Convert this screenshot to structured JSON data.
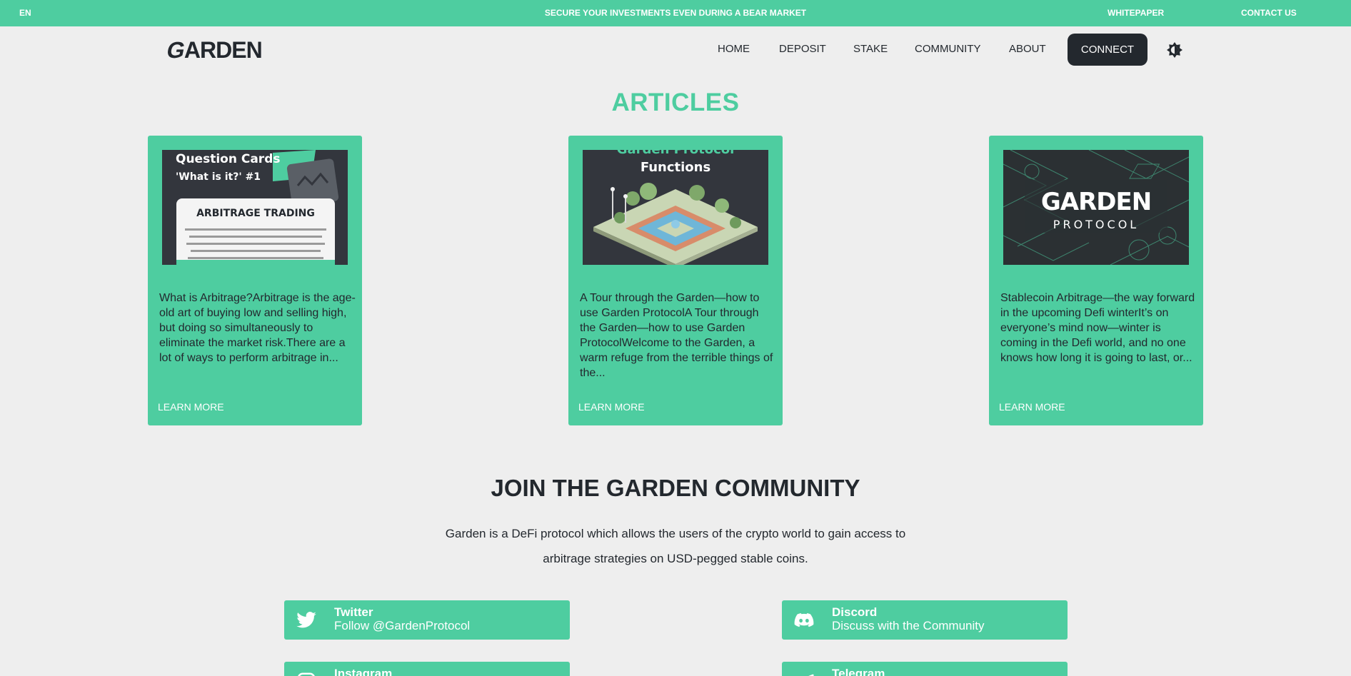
{
  "topbar": {
    "lang": "EN",
    "message": "SECURE YOUR INVESTMENTS EVEN DURING A BEAR MARKET",
    "whitepaper": "WHITEPAPER",
    "contact": "CONTACT US"
  },
  "header": {
    "logo_text": "ARDEN",
    "logo_initial": "G",
    "nav": {
      "home": "HOME",
      "deposit": "DEPOSIT",
      "stake": "STAKE",
      "community": "COMMUNITY",
      "about": "ABOUT"
    },
    "connect": "CONNECT",
    "theme_icon": "brightness-icon"
  },
  "articles": {
    "title": "ARTICLES",
    "learn_more": "LEARN MORE",
    "items": [
      {
        "image_title_1": "Question Cards",
        "image_title_2": "'What is it?' #1",
        "image_card_heading": "ARBITRAGE TRADING",
        "text": "What is Arbitrage?Arbitrage is the age-old art of buying low and selling high, but doing so simultaneously to eliminate the market risk.There are a lot of ways to perform arbitrage in..."
      },
      {
        "image_title_1": "Garden Protocol",
        "image_title_2": "Functions",
        "text": "A Tour through the Garden—how to use Garden ProtocolA Tour through the Garden—how to use Garden ProtocolWelcome to the Garden, a warm refuge from the terrible things of the..."
      },
      {
        "image_title_1": "GARDEN",
        "image_title_2": "PROTOCOL",
        "text": "Stablecoin Arbitrage—the way forward in the upcoming Defi winterIt’s on everyone’s mind now—winter is coming in the Defi world, and no one knows how long it is going to last, or..."
      }
    ]
  },
  "community": {
    "title": "JOIN THE GARDEN COMMUNITY",
    "description": "Garden is a DeFi protocol which allows the users of the crypto world to gain access to arbitrage strategies on USD-pegged stable coins.",
    "socials": {
      "twitter": {
        "name": "Twitter",
        "sub": "Follow @GardenProtocol",
        "icon": "twitter-icon"
      },
      "discord": {
        "name": "Discord",
        "sub": "Discuss with the Community",
        "icon": "discord-icon"
      },
      "instagram": {
        "name": "Instagram",
        "icon": "instagram-icon"
      },
      "telegram": {
        "name": "Telegram",
        "icon": "telegram-icon"
      }
    }
  },
  "colors": {
    "accent": "#4ecda0",
    "dark": "#23282e",
    "background": "#eeeeee"
  }
}
